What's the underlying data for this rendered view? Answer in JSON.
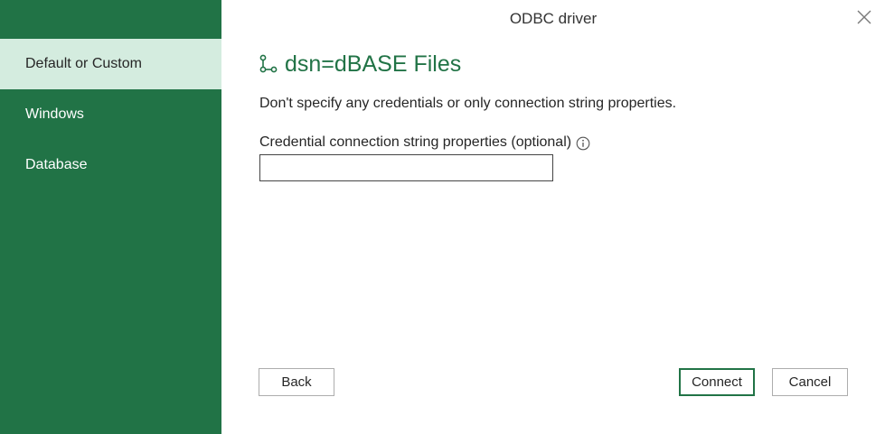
{
  "window": {
    "title": "ODBC driver"
  },
  "sidebar": {
    "items": [
      {
        "label": "Default or Custom",
        "selected": true
      },
      {
        "label": "Windows",
        "selected": false
      },
      {
        "label": "Database",
        "selected": false
      }
    ]
  },
  "main": {
    "heading_icon": "connection-icon",
    "heading": "dsn=dBASE Files",
    "description": "Don't specify any credentials or only connection string properties.",
    "field_label": "Credential connection string properties (optional)",
    "field_value": "",
    "info_icon": "info-icon"
  },
  "buttons": {
    "back": "Back",
    "connect": "Connect",
    "cancel": "Cancel"
  },
  "colors": {
    "sidebar": "#217346",
    "sidebar_selected": "#d4ecdf",
    "accent": "#217346"
  }
}
